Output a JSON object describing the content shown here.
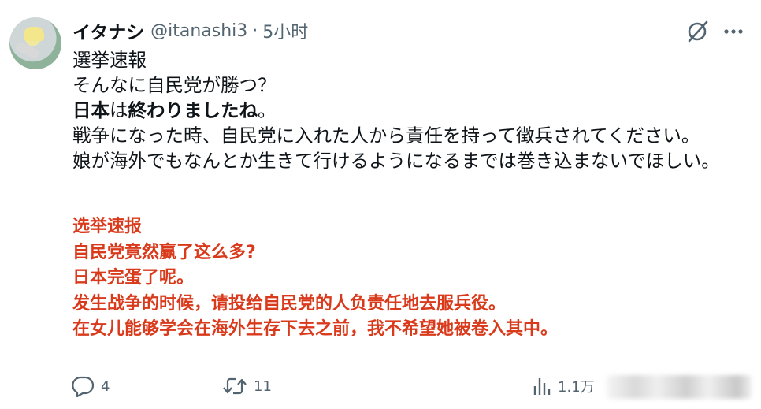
{
  "tweet": {
    "display_name": "イタナシ",
    "handle": "@itanashi3",
    "separator": "·",
    "time": "5小时",
    "body_ja": {
      "line1": "選挙速報",
      "line2": "そんなに自民党が勝つ？",
      "line3_part1": "日本",
      "line3_part2": "は",
      "line3_part3": "終わりましたね",
      "line3_part4": "。",
      "line4": "戦争になった時、自民党に入れた人から責任を持って徴兵されてください。",
      "line5": "娘が海外でもなんとか生きて行けるようになるまでは巻き込まないでほしい。"
    },
    "translation_zh": [
      "选举速报",
      "自民党竟然赢了这么多?",
      "日本完蛋了呢。",
      "发生战争的时候，请投给自民党的人负责任地去服兵役。",
      "在女儿能够学会在海外生存下去之前，我不希望她被卷入其中。"
    ],
    "actions": {
      "reply_count": "4",
      "retweet_count": "11",
      "views_count": "1.1万"
    }
  },
  "colors": {
    "text": "#0f1419",
    "secondary": "#536471",
    "translation": "#d93a1c",
    "background": "#ffffff"
  },
  "icons": [
    "grok-icon",
    "more-icon",
    "reply-icon",
    "retweet-icon",
    "views-icon"
  ]
}
